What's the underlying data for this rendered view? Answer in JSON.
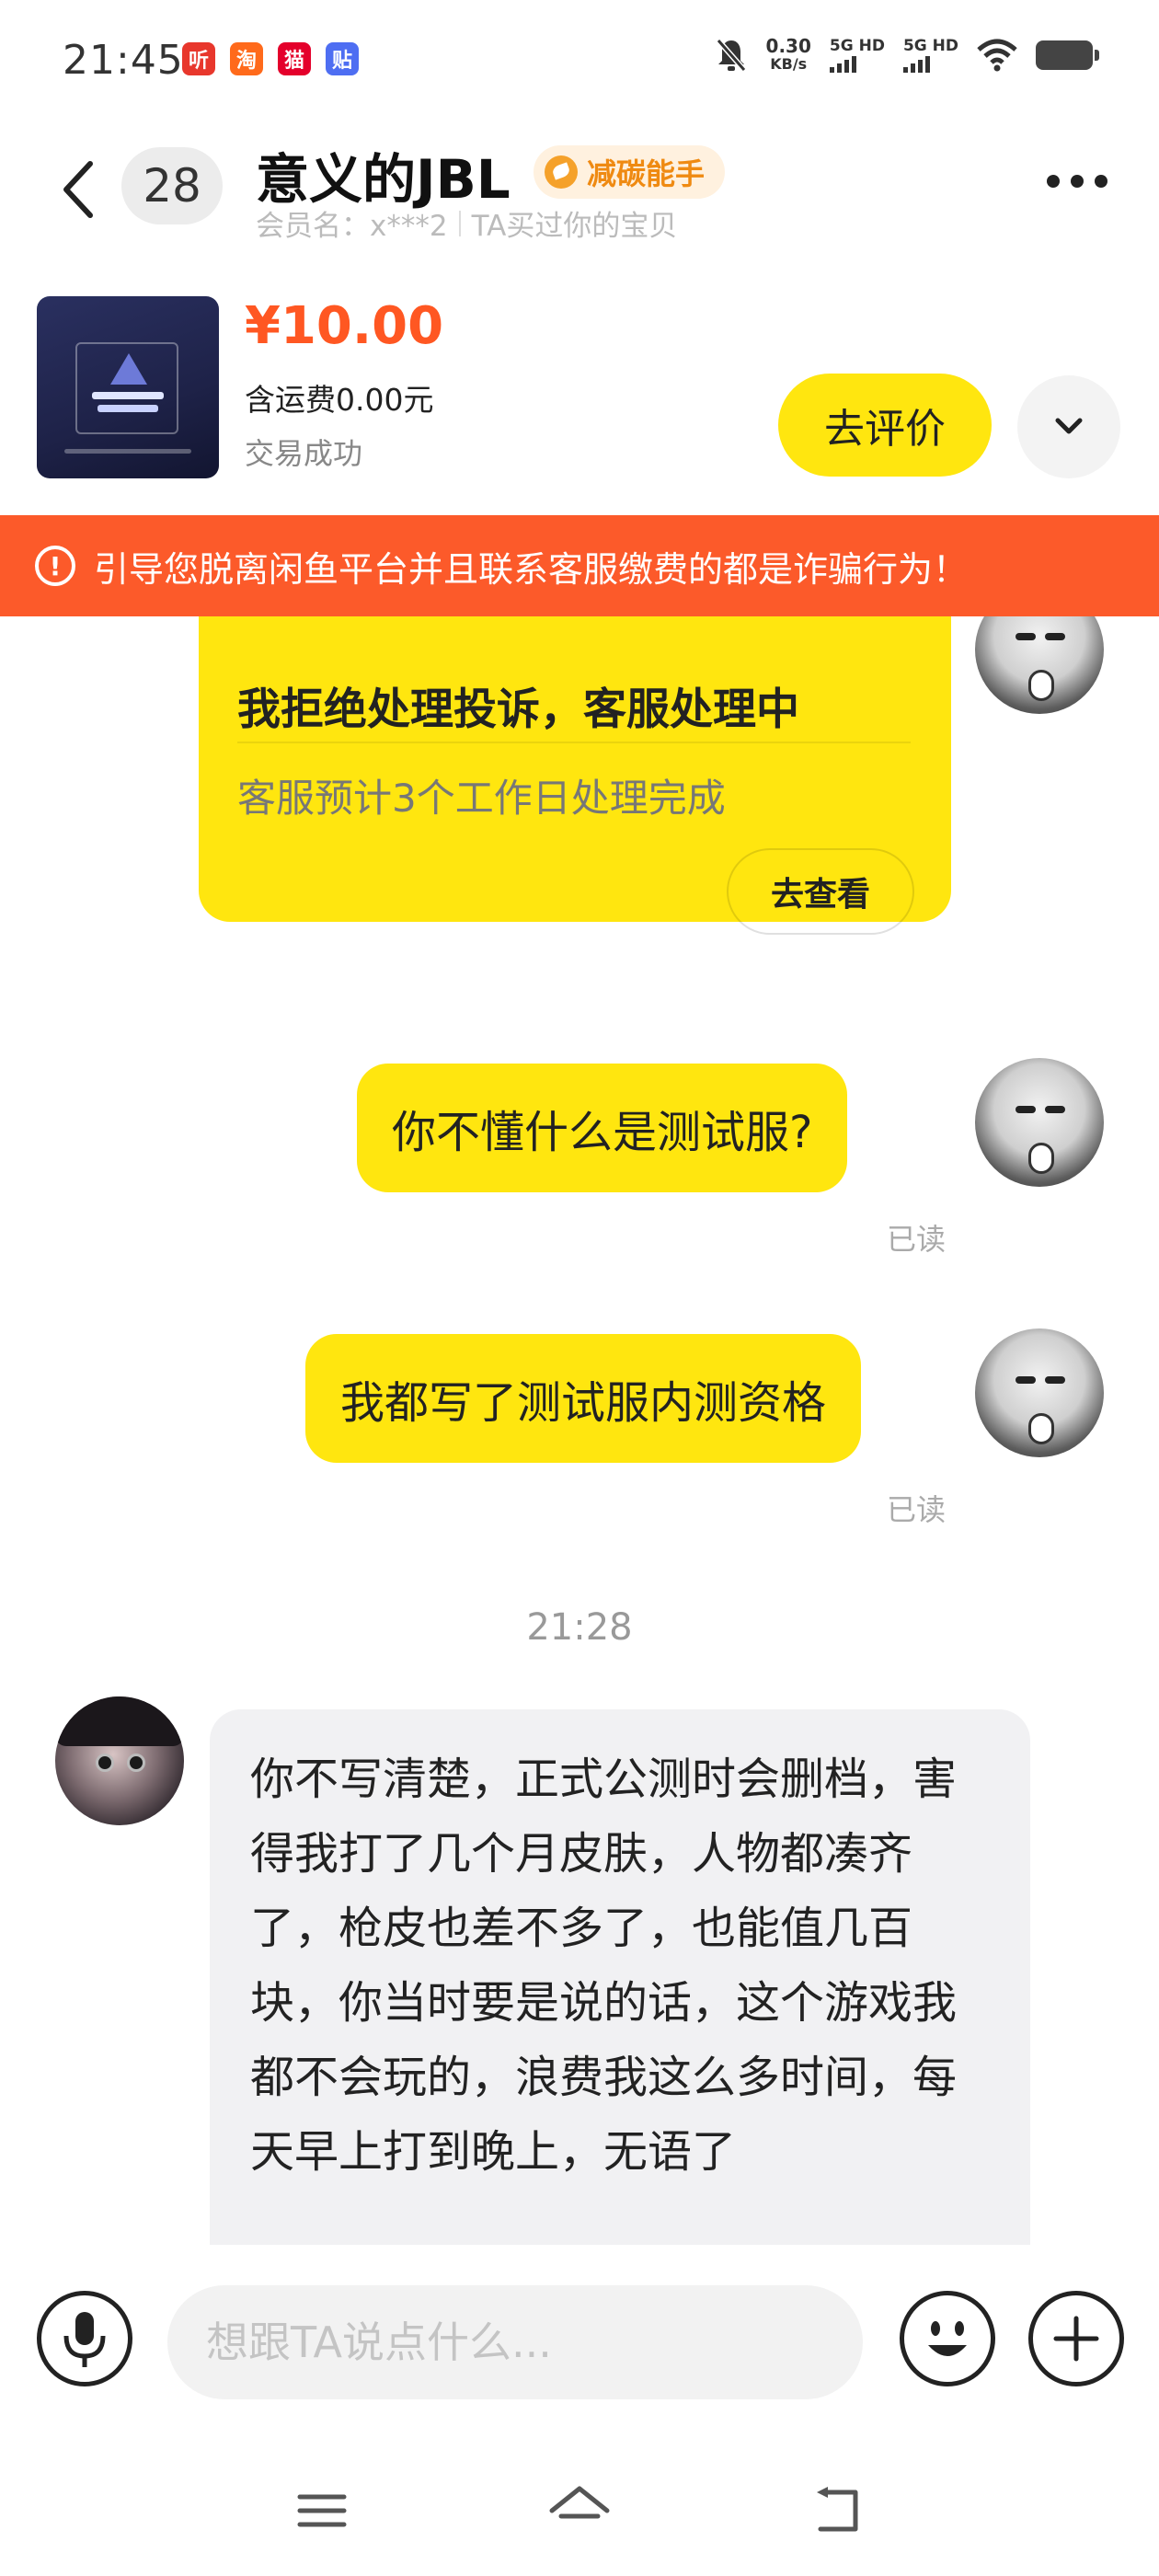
{
  "status_bar": {
    "time": "21:45",
    "apps": [
      {
        "icon": "listen-app-icon",
        "glyph": "听",
        "color": "#e8372c"
      },
      {
        "icon": "taobao-app-icon",
        "glyph": "淘",
        "color": "#ff6a1b"
      },
      {
        "icon": "tmall-app-icon",
        "glyph": "猫",
        "color": "#e4002b"
      },
      {
        "icon": "tieba-app-icon",
        "glyph": "贴",
        "color": "#4e6ef2"
      }
    ],
    "net_speed_value": "0.30",
    "net_speed_unit": "KB/s",
    "signal1_label": "5G HD",
    "signal2_label": "5G HD"
  },
  "header": {
    "unread_count": "28",
    "nickname": "意义的JBL",
    "badge_label": "减碳能手",
    "member_name": "会员名：x***2",
    "relation": "TA买过你的宝贝"
  },
  "order": {
    "price": "¥10.00",
    "shipping": "含运费0.00元",
    "status": "交易成功",
    "review_label": "去评价"
  },
  "warning": {
    "text": "引导您脱离闲鱼平台并且联系客服缴费的都是诈骗行为！"
  },
  "chat": {
    "complaint_card": {
      "title": "我拒绝处理投诉，客服处理中",
      "description": "客服预计3个工作日处理完成",
      "button_label": "去查看"
    },
    "messages_me": [
      {
        "text": "你不懂什么是测试服?",
        "status": "已读"
      },
      {
        "text": "我都写了测试服内测资格",
        "status": "已读"
      }
    ],
    "timestamp": "21:28",
    "message_other": {
      "text": "你不写清楚，正式公测时会删档，害得我打了几个月皮肤，人物都凑齐了，枪皮也差不多了，也能值几百块，你当时要是说的话，这个游戏我都不会玩的，浪费我这么多时间，每天早上打到晚上，无语了"
    }
  },
  "input": {
    "placeholder": "想跟TA说点什么..."
  },
  "colors": {
    "accent_yellow": "#ffe60f",
    "price_orange": "#ff5722",
    "warning_red": "#fc5a2a",
    "badge_orange": "#ef8a12"
  }
}
